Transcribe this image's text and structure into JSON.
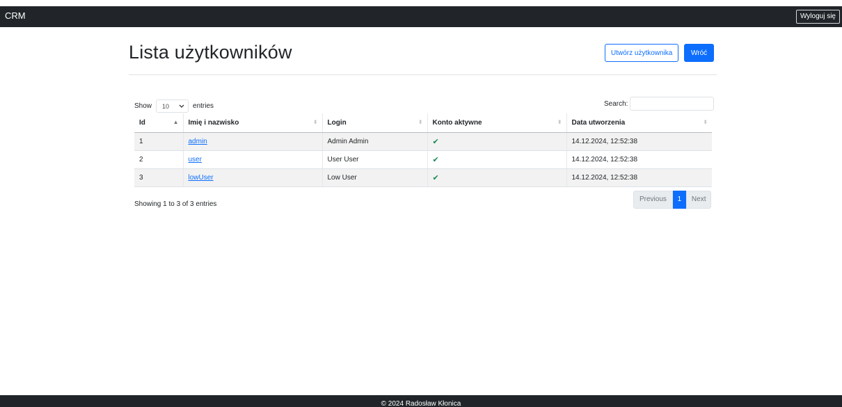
{
  "navbar": {
    "brand": "CRM",
    "logout_label": "Wyloguj się"
  },
  "page": {
    "title": "Lista użytkowników",
    "create_label": "Utwórz użytkownika",
    "back_label": "Wróć"
  },
  "table_controls": {
    "show_label": "Show",
    "entries_value": "10",
    "entries_label": "entries",
    "search_label": "Search:",
    "search_value": ""
  },
  "table": {
    "columns": [
      "Id",
      "Imię i nazwisko",
      "Login",
      "Konto aktywne",
      "Data utworzenia"
    ],
    "sorted_column": 0,
    "rows": [
      {
        "id": "1",
        "name": "admin",
        "login": "Admin Admin",
        "active": true,
        "created": "14.12.2024, 12:52:38"
      },
      {
        "id": "2",
        "name": "user",
        "login": "User User",
        "active": true,
        "created": "14.12.2024, 12:52:38"
      },
      {
        "id": "3",
        "name": "lowUser",
        "login": "Low User",
        "active": true,
        "created": "14.12.2024, 12:52:38"
      }
    ]
  },
  "pagination": {
    "info": "Showing 1 to 3 of 3 entries",
    "previous_label": "Previous",
    "current_page": "1",
    "next_label": "Next"
  },
  "footer": {
    "text": "© 2024 Radosław Kłonica"
  },
  "icons": {
    "sort": "sort-icon",
    "active": "check-icon",
    "dropdown": "chevron-down-icon"
  },
  "colors": {
    "navbar_bg": "#212529",
    "primary": "#0d6efd",
    "success": "#198754"
  }
}
